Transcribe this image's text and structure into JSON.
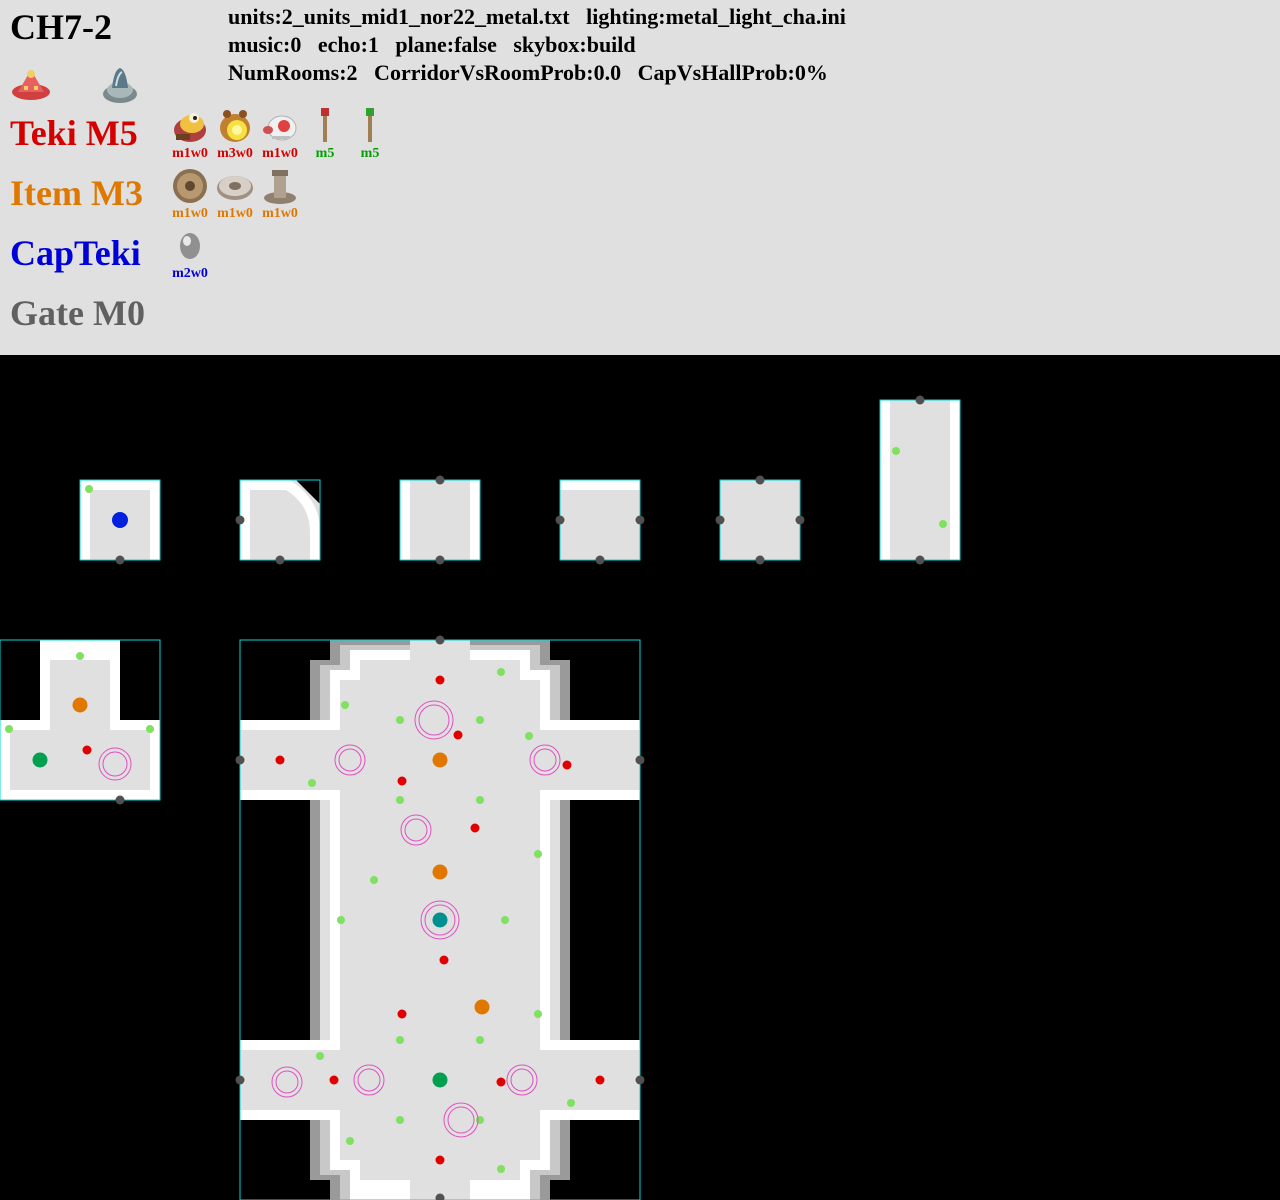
{
  "header": {
    "sublevel": "CH7-2",
    "info_lines": [
      "units:2_units_mid1_nor22_metal.txt   lighting:metal_light_cha.ini",
      "music:0   echo:1   plane:false   skybox:build",
      "NumRooms:2   CorridorVsRoomProb:0.0   CapVsHallProb:0%"
    ],
    "top_icons": [
      "ship-pod-icon",
      "geyser-icon"
    ]
  },
  "categories": [
    {
      "label": "Teki M5",
      "color": "#d40000",
      "entities": [
        {
          "icon": "bulborb-icon",
          "code": "m1w0"
        },
        {
          "icon": "iridescent-flint-beetle-icon",
          "code": "m3w0"
        },
        {
          "icon": "egg-bulb-icon",
          "code": "m1w0"
        },
        {
          "icon": "red-candypop-bud-icon",
          "code": "m5",
          "code_color": "#00a000"
        },
        {
          "icon": "green-clover-icon",
          "code": "m5",
          "code_color": "#00a000"
        }
      ]
    },
    {
      "label": "Item M3",
      "color": "#e07800",
      "entities": [
        {
          "icon": "gear-treasure-icon",
          "code": "m1w0"
        },
        {
          "icon": "nut-treasure-icon",
          "code": "m1w0"
        },
        {
          "icon": "bolt-treasure-icon",
          "code": "m1w0"
        }
      ]
    },
    {
      "label": "CapTeki",
      "color": "#0000d8",
      "entities": [
        {
          "icon": "egg-icon",
          "code": "m2w0"
        }
      ]
    },
    {
      "label": "Gate M0",
      "color": "#606060",
      "entities": []
    }
  ],
  "colors": {
    "header_bg": "#e0e0e0",
    "map_bg": "#000000",
    "tile_outline": "#00d8d8",
    "floor": "#e0e0e0",
    "wall": "#ffffff",
    "door_marker": "#505050",
    "teki_marker": "#e00000",
    "item_marker": "#e07800",
    "plant_marker": "#80e060",
    "start_marker": "#0020e0",
    "hole_marker": "#00a050",
    "geyser_marker": "#009090",
    "spawn_ring": "#e050c0"
  }
}
